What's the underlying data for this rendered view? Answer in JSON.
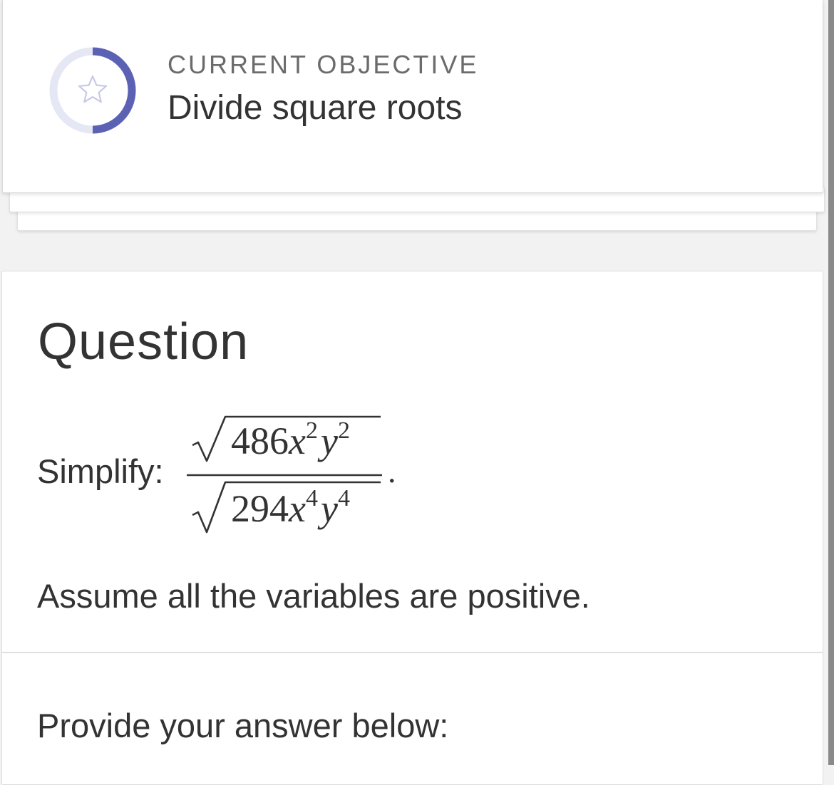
{
  "objective": {
    "label": "CURRENT OBJECTIVE",
    "title": "Divide square roots",
    "icon": "star-icon",
    "progress": 0.5,
    "ring_color": "#5b62b3",
    "ring_track_color": "#e6e7f4"
  },
  "question": {
    "heading": "Question",
    "prompt_label": "Simplify:",
    "fraction": {
      "numerator": {
        "coefficient": "486",
        "var1": "x",
        "exp1": "2",
        "var2": "y",
        "exp2": "2"
      },
      "denominator": {
        "coefficient": "294",
        "var1": "x",
        "exp1": "4",
        "var2": "y",
        "exp2": "4"
      },
      "trailing": "."
    },
    "assumption": "Assume all the variables are positive."
  },
  "answer": {
    "prompt": "Provide your answer below:"
  }
}
